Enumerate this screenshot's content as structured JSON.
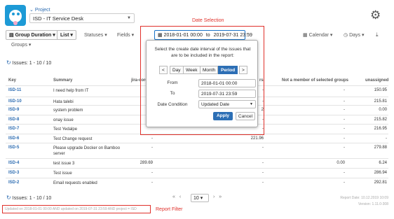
{
  "header": {
    "project_label": "Project",
    "project_value": "ISD - IT Service Desk"
  },
  "annotations": {
    "date_selection": "Date Selection",
    "report_filter": "Report Filter"
  },
  "toolbar": {
    "group_duration": "Group Duration",
    "list": "List",
    "statuses": "Statuses",
    "fields": "Fields",
    "groups": "Groups",
    "calendar": "Calendar",
    "days": "Days",
    "date_range": {
      "from": "2018-01-01 00:00",
      "to_label": "to",
      "to": "2019-07-31 23:59"
    }
  },
  "issues_count_top": "Issues: 1 - 10 / 10",
  "issues_count_bottom": "Issues: 1 - 10 / 10",
  "table": {
    "headers": {
      "key": "Key",
      "summary": "Summary",
      "col3": "jira-core",
      "col4": "rs",
      "col5": "Not a member of selected groups",
      "col6": "unassigned"
    },
    "rows": [
      {
        "key": "ISD-11",
        "summary": "I need help from IT",
        "c3": "",
        "c4": "-",
        "c5": "-",
        "c6": "150.95"
      },
      {
        "key": "ISD-10",
        "summary": "Hata talebi",
        "c3": "",
        "c4": "-",
        "c5": "-",
        "c6": "215.81"
      },
      {
        "key": "ISD-9",
        "summary": "system problem",
        "c3": "",
        "c4": "2",
        "c5": "-",
        "c6": "0.00"
      },
      {
        "key": "ISD-8",
        "summary": "onay issue",
        "c3": "",
        "c4": "-",
        "c5": "-",
        "c6": "215.82"
      },
      {
        "key": "ISD-7",
        "summary": "Test Yedalpe",
        "c3": "",
        "c4": "-",
        "c5": "-",
        "c6": "216.95"
      },
      {
        "key": "ISD-6",
        "summary": "Test Change request",
        "c3": "-",
        "c4": "221.96",
        "c5": "-",
        "c6": "-"
      },
      {
        "key": "ISD-5",
        "summary": "Please upgrade Docker on Bamboo server",
        "c3": "-",
        "c4": "-",
        "c5": "-",
        "c6": "279.88"
      },
      {
        "key": "ISD-4",
        "summary": "test issue 3",
        "c3": "289.69",
        "c4": "-",
        "c5": "0.00",
        "c6": "6.24"
      },
      {
        "key": "ISD-3",
        "summary": "Test issue",
        "c3": "-",
        "c4": "-",
        "c5": "-",
        "c6": "286.94"
      },
      {
        "key": "ISD-2",
        "summary": "Email requests enabled",
        "c3": "-",
        "c4": "-",
        "c5": "-",
        "c6": "292.81"
      }
    ]
  },
  "popup": {
    "description": "Select the create date interval of the issues that are to be included in the report:",
    "prev": "<",
    "next": ">",
    "periods": [
      "Day",
      "Week",
      "Month",
      "Period"
    ],
    "from_label": "From",
    "from_value": "2018-01-01 00:00",
    "to_label": "To",
    "to_value": "2019-07-31 23:59",
    "condition_label": "Date Condition",
    "condition_value": "Updated Date",
    "apply": "Apply",
    "cancel": "Cancel"
  },
  "pager": {
    "prev": "«",
    "prev1": "‹",
    "size": "10",
    "next1": "›",
    "next": "»"
  },
  "footer": {
    "filter_text": "Updated on 2018-01-01 00:00 AND updated on 2019-07-31 23:59 AND project = ISD",
    "report_date": "Report Date: 10.12.2019 10:09",
    "version": "Version: 1.11.0-308"
  },
  "icons": {
    "settings": "gear-icon",
    "calendar": "calendar-icon",
    "sync": "sync-icon",
    "export": "download-icon"
  }
}
